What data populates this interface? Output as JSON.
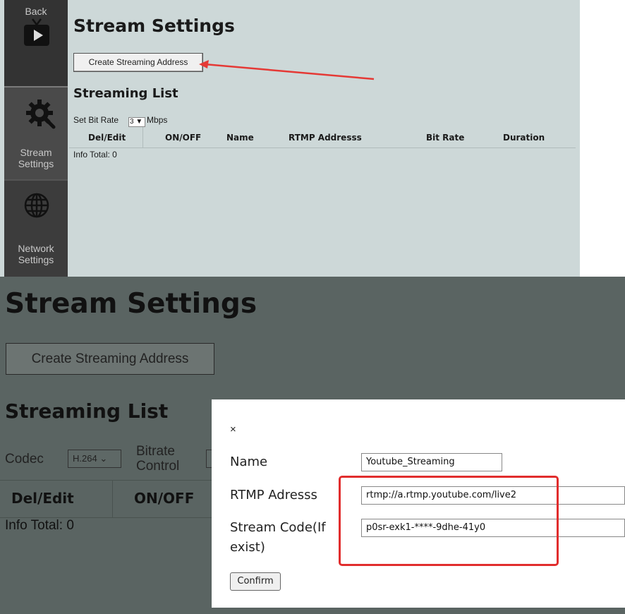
{
  "top": {
    "sidebar": {
      "back_label": "Back",
      "stream_label_line1": "Stream",
      "stream_label_line2": "Settings",
      "network_label_line1": "Network",
      "network_label_line2": "Settings"
    },
    "title": "Stream Settings",
    "create_button": "Create Streaming Address",
    "list_heading": "Streaming List",
    "bitrate_label": "Set Bit Rate",
    "bitrate_value": "3",
    "bitrate_unit": "Mbps",
    "columns": [
      "Del/Edit",
      "ON/OFF",
      "Name",
      "RTMP Addresss",
      "Bit Rate",
      "Duration"
    ],
    "info_total": "Info Total: 0",
    "arrow_color": "#e53935"
  },
  "bottom": {
    "title": "Stream Settings",
    "create_button": "Create Streaming Address",
    "list_heading": "Streaming List",
    "codec_label": "Codec",
    "codec_value": "H.264",
    "bitrate_control_line1": "Bitrate",
    "bitrate_control_line2": "Control",
    "columns": [
      "Del/Edit",
      "ON/OFF"
    ],
    "info_total": "Info Total: 0"
  },
  "modal": {
    "close": "×",
    "name_label": "Name",
    "name_value": "Youtube_Streaming",
    "rtmp_label": "RTMP Adresss",
    "rtmp_value": "rtmp://a.rtmp.youtube.com/live2",
    "code_label_line1": "Stream Code(If",
    "code_label_line2": "exist)",
    "code_value": "p0sr-exk1-****-9dhe-41y0",
    "confirm": "Confirm",
    "highlight_color": "#e12d2d"
  }
}
